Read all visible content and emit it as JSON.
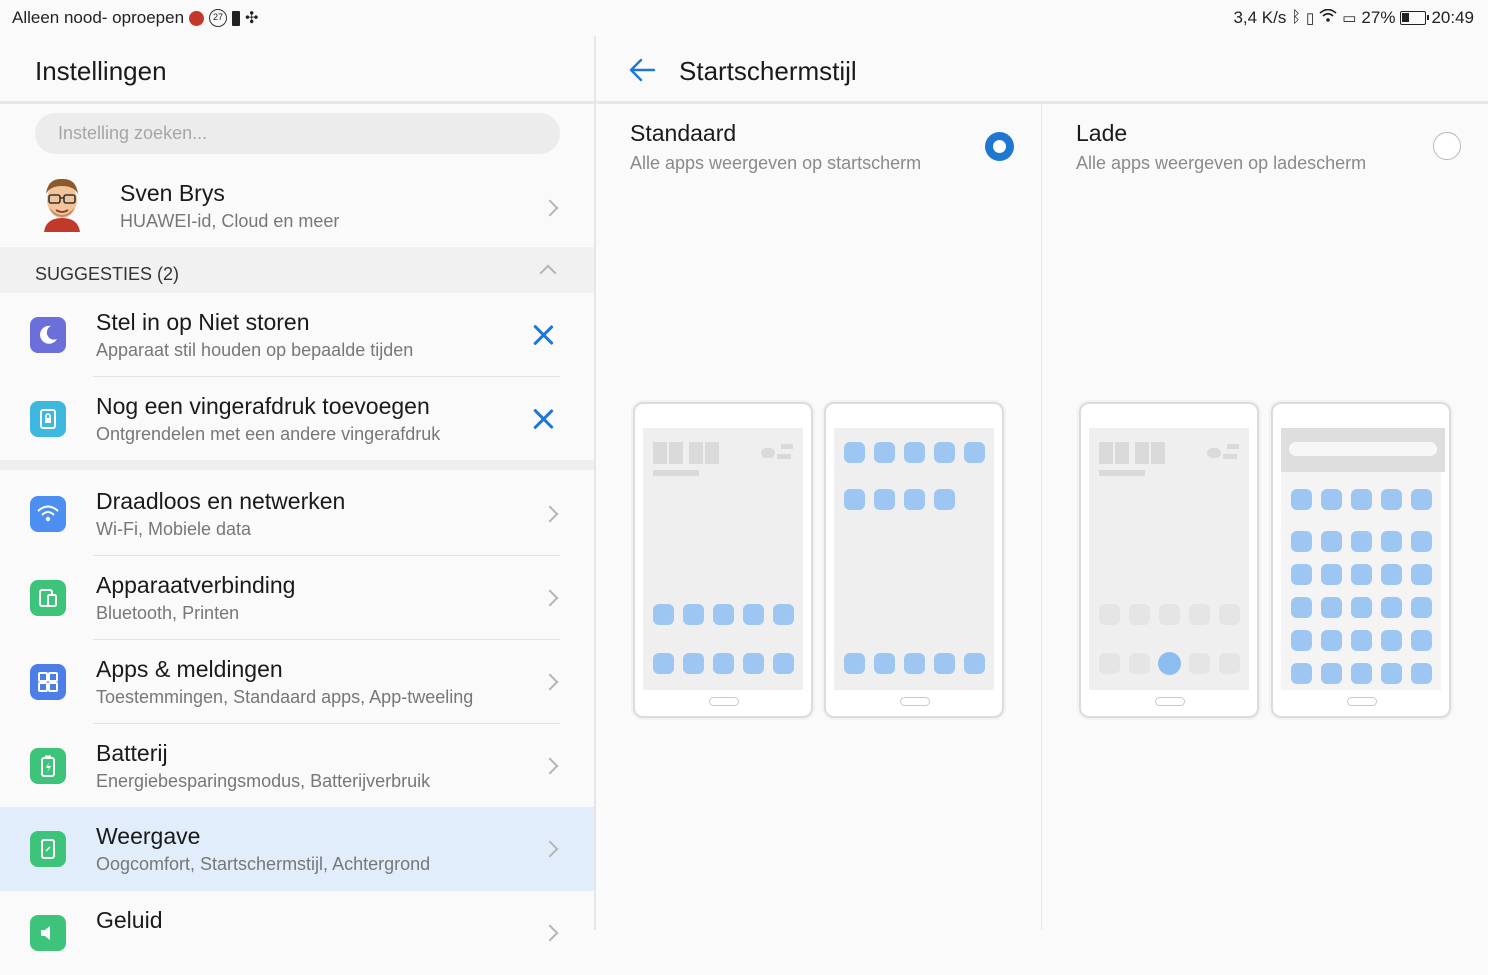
{
  "status_bar": {
    "carrier_text": "Alleen nood- oproepen",
    "notif_badge": "27",
    "speed": "3,4 K/s",
    "battery_pct": "27%",
    "time": "20:49"
  },
  "left": {
    "title": "Instellingen",
    "search_placeholder": "Instelling zoeken...",
    "profile": {
      "name": "Sven Brys",
      "sub": "HUAWEI-id, Cloud en meer"
    },
    "suggestions_label": "SUGGESTIES (2)",
    "suggestions": [
      {
        "title": "Stel in op Niet storen",
        "sub": "Apparaat stil houden op bepaalde tijden",
        "icon": "moon-icon",
        "color": "#6b6fd9"
      },
      {
        "title": "Nog een vingerafdruk toevoegen",
        "sub": "Ontgrendelen met een andere vingerafdruk",
        "icon": "fingerprint-lock-icon",
        "color": "#3fb8e0"
      }
    ],
    "items": [
      {
        "title": "Draadloos en netwerken",
        "sub": "Wi-Fi, Mobiele data",
        "icon": "wifi-icon",
        "color": "#4d8ff0"
      },
      {
        "title": "Apparaatverbinding",
        "sub": "Bluetooth, Printen",
        "icon": "device-connection-icon",
        "color": "#3ec37a"
      },
      {
        "title": "Apps & meldingen",
        "sub": "Toestemmingen, Standaard apps, App-tweeling",
        "icon": "apps-grid-icon",
        "color": "#4d7ee8"
      },
      {
        "title": "Batterij",
        "sub": "Energiebesparingsmodus, Batterijverbruik",
        "icon": "battery-icon",
        "color": "#3ec37a"
      },
      {
        "title": "Weergave",
        "sub": "Oogcomfort, Startschermstijl, Achtergrond",
        "icon": "display-icon",
        "color": "#3ec37a",
        "selected": true
      },
      {
        "title": "Geluid",
        "sub": "",
        "icon": "sound-icon",
        "color": "#3ec37a"
      }
    ]
  },
  "right": {
    "title": "Startschermstijl",
    "options": [
      {
        "title": "Standaard",
        "sub": "Alle apps weergeven op startscherm",
        "selected": true
      },
      {
        "title": "Lade",
        "sub": "Alle apps weergeven op ladescherm",
        "selected": false
      }
    ]
  },
  "colors": {
    "accent": "#1e78d2",
    "selected_row": "#e1edfa"
  }
}
